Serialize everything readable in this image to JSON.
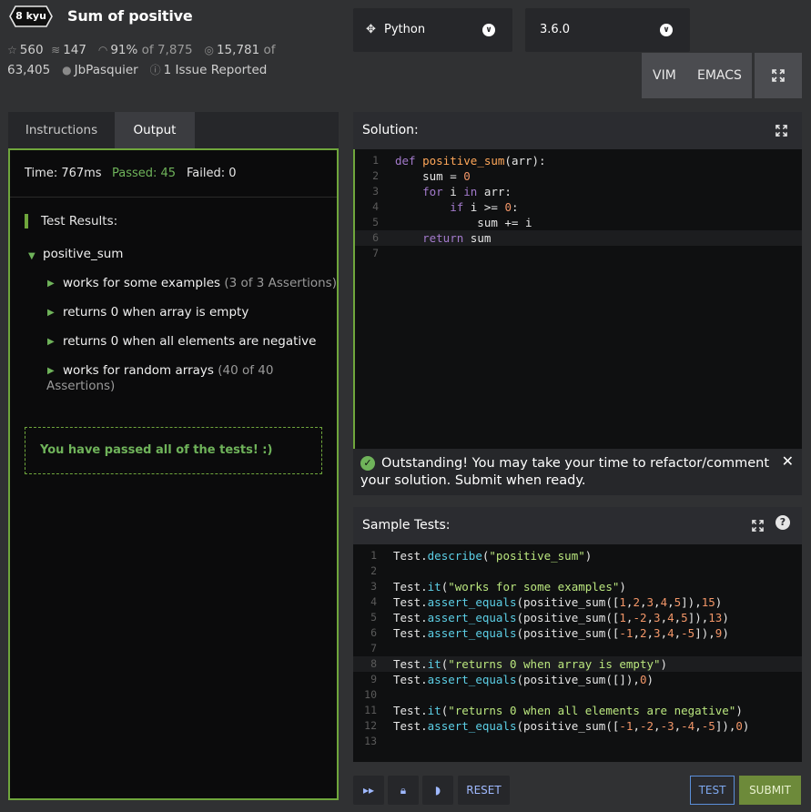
{
  "kata": {
    "rank": "8 kyu",
    "title": "Sum of positive",
    "stars": "560",
    "collections": "147",
    "satisfaction": "91%",
    "satisfaction_of": "of 7,875",
    "completed": "15,781",
    "completed_of_prefix": "of",
    "completed_total": "63,405",
    "author": "JbPasquier",
    "issues": "1 Issue Reported"
  },
  "language": {
    "selected": "Python"
  },
  "version": {
    "selected": "3.6.0"
  },
  "keymap": {
    "vim": "VIM",
    "emacs": "EMACS"
  },
  "tabs": [
    {
      "label": "Instructions"
    },
    {
      "label": "Output"
    }
  ],
  "output": {
    "time": "Time: 767ms",
    "passed": "Passed: 45",
    "failed": "Failed: 0",
    "results_heading": "Test Results:",
    "describe": "positive_sum",
    "tests": [
      {
        "label": "works for some examples",
        "assertions": "(3 of 3 Assertions)"
      },
      {
        "label": "returns 0 when array is empty",
        "assertions": ""
      },
      {
        "label": "returns 0 when all elements are negative",
        "assertions": ""
      },
      {
        "label": "works for random arrays",
        "assertions": "(40 of 40",
        "assertions2": "Assertions)"
      }
    ],
    "pass_message": "You have passed all of the tests! :)"
  },
  "solution": {
    "heading": "Solution:",
    "line_numbers": [
      "1",
      "2",
      "3",
      "4",
      "5",
      "6",
      "7"
    ],
    "lines": [
      "def positive_sum(arr):",
      "    sum = 0",
      "    for i in arr:",
      "        if i >= 0:",
      "            sum += i",
      "    return sum",
      ""
    ]
  },
  "notice": {
    "message": "Outstanding! You may take your time to refactor/comment your solution. Submit when ready."
  },
  "sample_tests": {
    "heading": "Sample Tests:",
    "line_numbers": [
      "1",
      "2",
      "3",
      "4",
      "5",
      "6",
      "7",
      "8",
      "9",
      "10",
      "11",
      "12",
      "13"
    ],
    "lines": [
      "Test.describe(\"positive_sum\")",
      "",
      "Test.it(\"works for some examples\")",
      "Test.assert_equals(positive_sum([1,2,3,4,5]),15)",
      "Test.assert_equals(positive_sum([1,-2,3,4,5]),13)",
      "Test.assert_equals(positive_sum([-1,2,3,4,-5]),9)",
      "",
      "Test.it(\"returns 0 when array is empty\")",
      "Test.assert_equals(positive_sum([]),0)",
      "",
      "Test.it(\"returns 0 when all elements are negative\")",
      "Test.assert_equals(positive_sum([-1,-2,-3,-4,-5]),0)",
      ""
    ]
  },
  "actions": {
    "reset": "RESET",
    "test": "TEST",
    "submit": "SUBMIT"
  },
  "icons": [
    "star-icon",
    "collection-icon",
    "eye-icon",
    "target-icon",
    "user-icon",
    "issue-icon",
    "python-icon",
    "chevron-down-icon",
    "fullscreen-icon",
    "check-icon",
    "close-icon",
    "question-icon",
    "skip-icon",
    "lock-icon",
    "chat-icon"
  ],
  "colors": {
    "accent_green": "#6fb35a",
    "border_green": "#6fa63c",
    "submit_bg": "#6d8a3a",
    "test_border": "#5b8fd9"
  }
}
